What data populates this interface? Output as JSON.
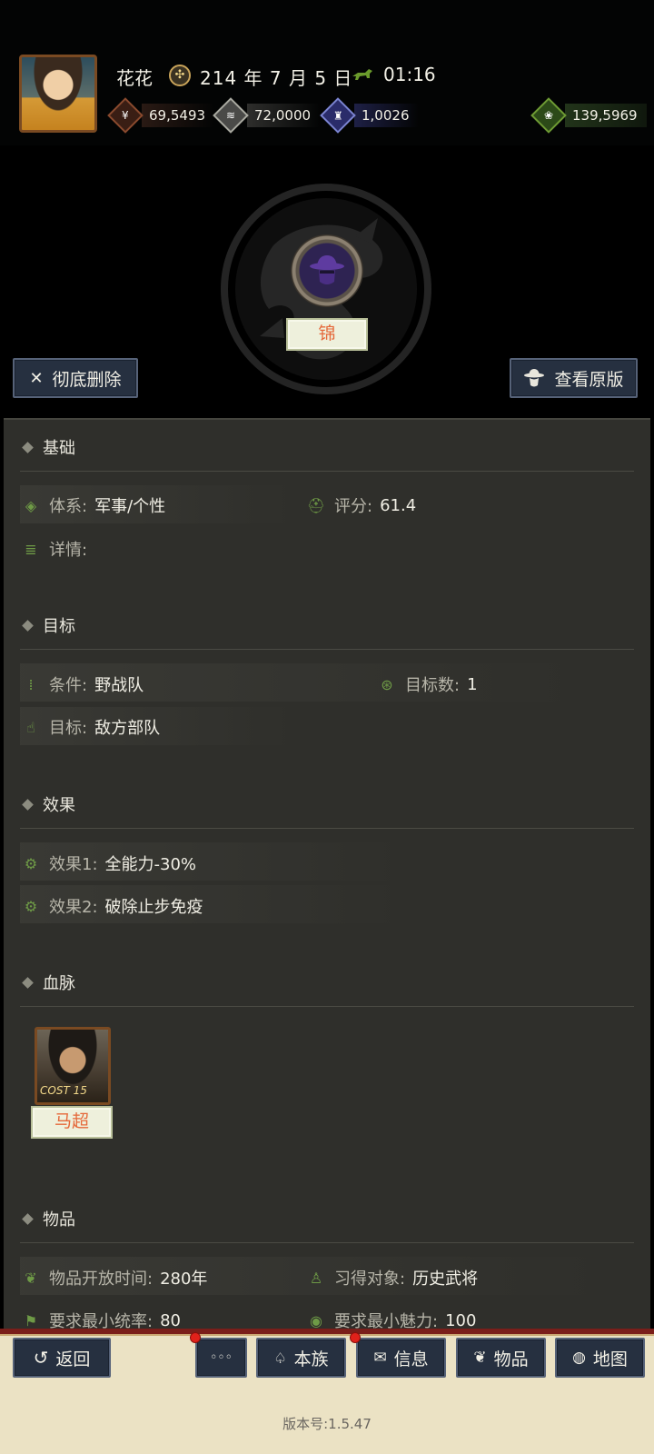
{
  "header": {
    "username": "花花",
    "date": "214 年 7 月 5 日",
    "time": "01:16",
    "resources": [
      {
        "icon": "gold-icon",
        "value": "69,5493"
      },
      {
        "icon": "silver-icon",
        "value": "72,0000"
      },
      {
        "icon": "soldier-icon",
        "value": "1,0026"
      },
      {
        "icon": "grain-icon",
        "value": "139,5969"
      }
    ]
  },
  "emblem": {
    "name": "锦"
  },
  "actions": {
    "delete_label": "彻底删除",
    "view_label": "查看原版"
  },
  "sections": {
    "basic": {
      "title": "基础",
      "system_label": "体系:",
      "system_value": "军事/个性",
      "score_label": "评分:",
      "score_value": "61.4",
      "detail_label": "详情:"
    },
    "target": {
      "title": "目标",
      "condition_label": "条件:",
      "condition_value": "野战队",
      "count_label": "目标数:",
      "count_value": "1",
      "target_label": "目标:",
      "target_value": "敌方部队"
    },
    "effect": {
      "title": "效果",
      "effect1_label": "效果1:",
      "effect1_value": "全能力-30%",
      "effect2_label": "效果2:",
      "effect2_value": "破除止步免疫"
    },
    "bloodline": {
      "title": "血脉",
      "hero_name": "马超",
      "cost": "COST 15"
    },
    "item": {
      "title": "物品",
      "open_time_label": "物品开放时间:",
      "open_time_value": "280年",
      "learn_label": "习得对象:",
      "learn_value": "历史武将",
      "min_command_label": "要求最小统率:",
      "min_command_value": "80",
      "min_charm_label": "要求最小魅力:",
      "min_charm_value": "100"
    }
  },
  "nav": {
    "back": "返回",
    "more": "◦◦◦",
    "clan": "本族",
    "info": "信息",
    "items": "物品",
    "map": "地图"
  },
  "version": "版本号:1.5.47",
  "colors": {
    "accent_green": "#6e9a46",
    "tag_text": "#e5683a",
    "button_bg": "#263040"
  }
}
